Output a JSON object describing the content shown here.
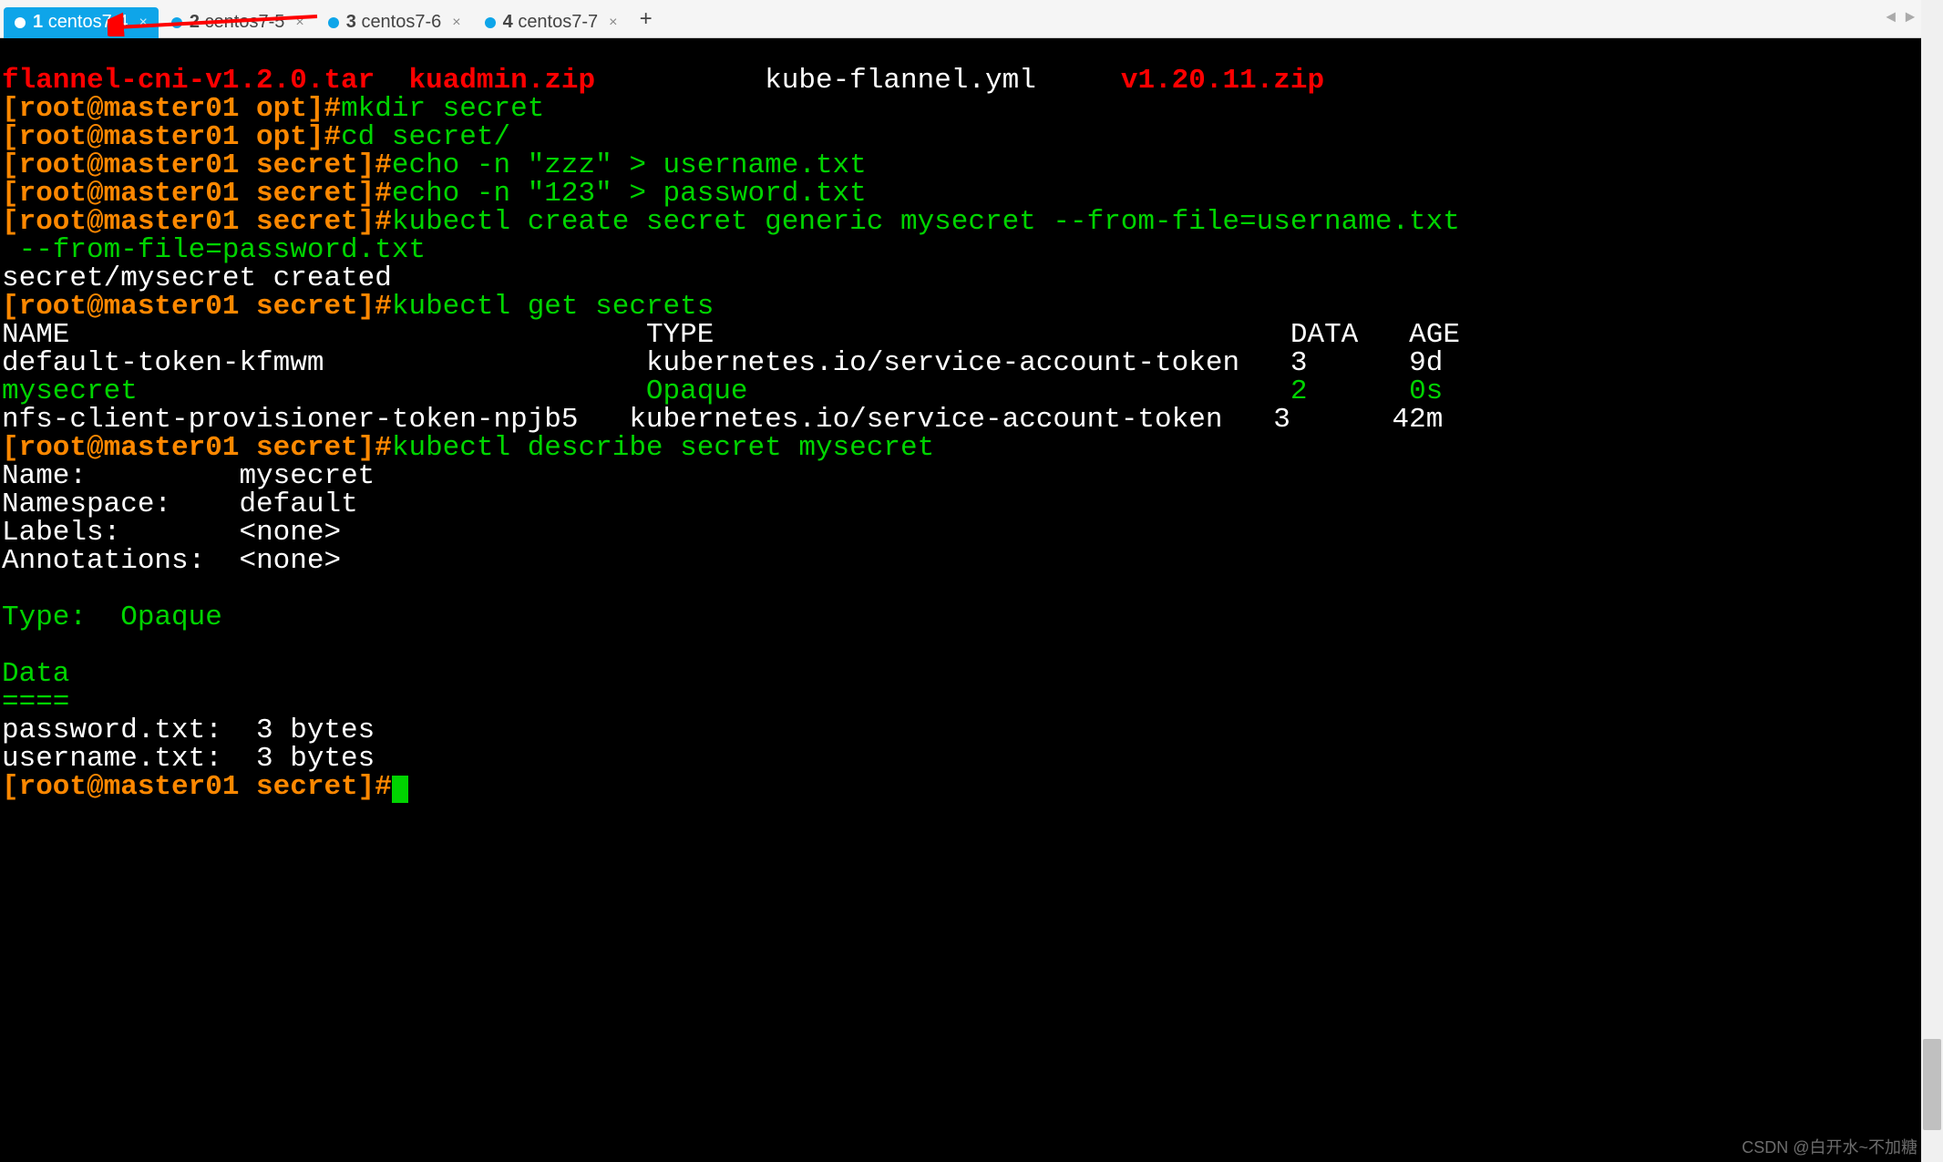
{
  "tabs": [
    {
      "num": "1",
      "label": "centos7-4",
      "active": true
    },
    {
      "num": "2",
      "label": "centos7-5",
      "active": false
    },
    {
      "num": "3",
      "label": "centos7-6",
      "active": false
    },
    {
      "num": "4",
      "label": "centos7-7",
      "active": false
    }
  ],
  "tab_add": "+",
  "tab_close": "×",
  "nav": {
    "prev": "◄",
    "next": "►",
    "down": "▾"
  },
  "terminal": {
    "ls_line": {
      "f1": "flannel-cni-v1.2.0.tar",
      "f2": "kuadmin.zip",
      "f3": "kube-flannel.yml",
      "f4": "v1.20.11.zip"
    },
    "prompts": {
      "opt": "[root@master01 opt]#",
      "secret": "[root@master01 secret]#"
    },
    "cmds": {
      "mkdir": "mkdir secret",
      "cd": "cd secret/",
      "echo1": "echo -n \"zzz\" > username.txt",
      "echo2": "echo -n \"123\" > password.txt",
      "create": "kubectl create secret generic mysecret --from-file=username.txt",
      "create2": " --from-file=password.txt",
      "created": "secret/mysecret created",
      "get": "kubectl get secrets",
      "describe": "kubectl describe secret mysecret"
    },
    "table": {
      "h1": "NAME",
      "h2": "TYPE",
      "h3": "DATA",
      "h4": "AGE",
      "rows": [
        {
          "name": "default-token-kfmwm",
          "type": "kubernetes.io/service-account-token",
          "data": "3",
          "age": "9d",
          "hl": false
        },
        {
          "name": "mysecret",
          "type": "Opaque",
          "data": "2",
          "age": "0s",
          "hl": true
        },
        {
          "name": "nfs-client-provisioner-token-npjb5",
          "type": "kubernetes.io/service-account-token",
          "data": "3",
          "age": "42m",
          "hl": false
        }
      ]
    },
    "describe": {
      "name_k": "Name:",
      "name_v": "mysecret",
      "ns_k": "Namespace:",
      "ns_v": "default",
      "lbl_k": "Labels:",
      "lbl_v": "<none>",
      "ann_k": "Annotations:",
      "ann_v": "<none>",
      "type_k": "Type:",
      "type_v": "Opaque",
      "data_h": "Data",
      "data_s": "====",
      "pw": "password.txt:  3 bytes",
      "un": "username.txt:  3 bytes"
    }
  },
  "watermark": "CSDN @白开水~不加糖"
}
